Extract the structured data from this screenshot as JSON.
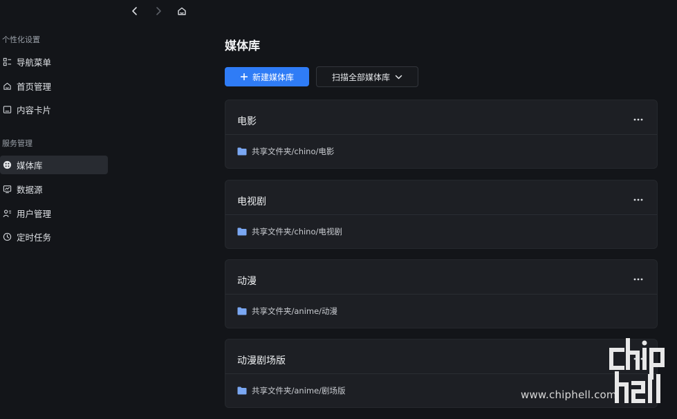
{
  "nav": {
    "back_icon": "chevron-left-icon",
    "forward_icon": "chevron-right-icon",
    "home_icon": "home-icon"
  },
  "sidebar": {
    "sections": [
      {
        "title": "个性化设置",
        "items": [
          {
            "label": "导航菜单",
            "icon": "menu-grid-icon"
          },
          {
            "label": "首页管理",
            "icon": "home-icon"
          },
          {
            "label": "内容卡片",
            "icon": "card-icon"
          }
        ]
      },
      {
        "title": "服务管理",
        "items": [
          {
            "label": "媒体库",
            "icon": "media-library-icon",
            "active": true
          },
          {
            "label": "数据源",
            "icon": "data-source-icon"
          },
          {
            "label": "用户管理",
            "icon": "users-icon"
          },
          {
            "label": "定时任务",
            "icon": "clock-icon"
          }
        ]
      }
    ]
  },
  "main": {
    "title": "媒体库",
    "new_button": "新建媒体库",
    "scan_button": "扫描全部媒体库",
    "libraries": [
      {
        "name": "电影",
        "path": "共享文件夹/chino/电影"
      },
      {
        "name": "电视剧",
        "path": "共享文件夹/chino/电视剧"
      },
      {
        "name": "动漫",
        "path": "共享文件夹/anime/动漫"
      },
      {
        "name": "动漫剧场版",
        "path": "共享文件夹/anime/剧场版"
      }
    ]
  },
  "watermark": {
    "text": "www.chiphell.com"
  },
  "colors": {
    "accent": "#2f7cf6",
    "background": "#131519",
    "card": "#1d1f24",
    "folder": "#7aa7f2"
  }
}
